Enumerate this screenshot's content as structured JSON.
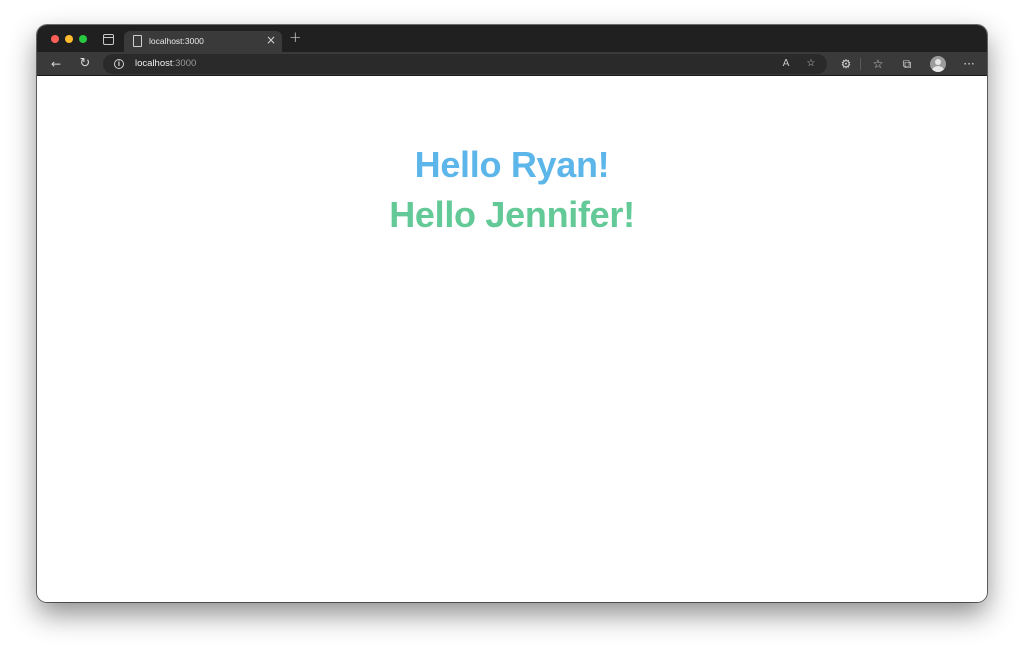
{
  "browser": {
    "tab": {
      "title": "localhost:3000",
      "close": "×"
    },
    "new_tab": "+",
    "toolbar": {
      "back": "←",
      "reload": "↻",
      "url_host": "localhost",
      "url_port": ":3000",
      "info": "i",
      "read_aloud": "A",
      "add_favorite": "☆",
      "extensions": "⚙",
      "favorites": "☆",
      "collections": "⧉",
      "more": "···"
    }
  },
  "page": {
    "greetings": [
      {
        "text": "Hello Ryan!",
        "color": "#5db6e9"
      },
      {
        "text": "Hello Jennifer!",
        "color": "#62c997"
      }
    ]
  },
  "colors": {
    "tab_strip": "#202020",
    "toolbar": "#3a3a3a",
    "page_background": "#ffffff"
  }
}
